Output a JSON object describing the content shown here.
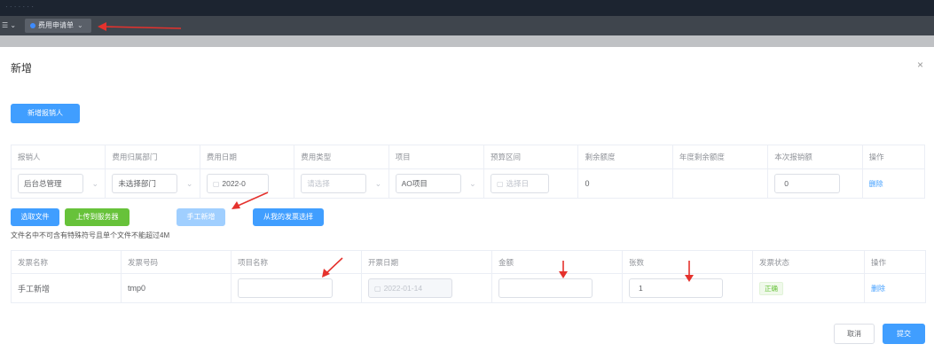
{
  "topbar": {
    "text": "· · · · · · ·"
  },
  "tabbar": {
    "menu_label": "☰ ⌄",
    "tabs": [
      {
        "label": "费用申请单",
        "close": "⌄"
      }
    ]
  },
  "dialog": {
    "title": "新增",
    "close": "×",
    "add_reimburser_button": "新增报销人",
    "reimburse_table": {
      "headers": [
        "报销人",
        "费用归属部门",
        "费用日期",
        "费用类型",
        "项目",
        "预算区间",
        "剩余额度",
        "年度剩余额度",
        "本次报销额",
        "操作"
      ],
      "row": {
        "person": "后台总管理",
        "dept": "未选择部门",
        "date": "2022-0",
        "type_placeholder": "请选择",
        "project": "AO项目",
        "budget_placeholder": "选择日",
        "remaining": "0",
        "annual_remaining": "",
        "amount": "0",
        "action": "删除"
      }
    },
    "file_buttons": {
      "select_file": "选取文件",
      "upload": "上传到服务器",
      "manual_add": "手工新增",
      "from_invoice": "从我的发票选择"
    },
    "hint": "文件名中不可含有特殊符号且单个文件不能超过4M",
    "invoice_table": {
      "headers": [
        "发票名称",
        "发票号码",
        "项目名称",
        "开票日期",
        "金额",
        "张数",
        "发票状态",
        "操作"
      ],
      "row": {
        "name": "手工新增",
        "number": "tmp0",
        "project_name": "",
        "date": "2022-01-14",
        "amount": "",
        "count": "1",
        "status": "正确",
        "action": "删除"
      }
    },
    "cancel": "取消",
    "submit": "提交"
  },
  "colors": {
    "primary": "#409eff",
    "success": "#67c23a",
    "arrow": "#e5322d"
  },
  "icons": {
    "calendar": "calendar-icon",
    "chevron": "chevron-down-icon",
    "close": "close-icon"
  }
}
